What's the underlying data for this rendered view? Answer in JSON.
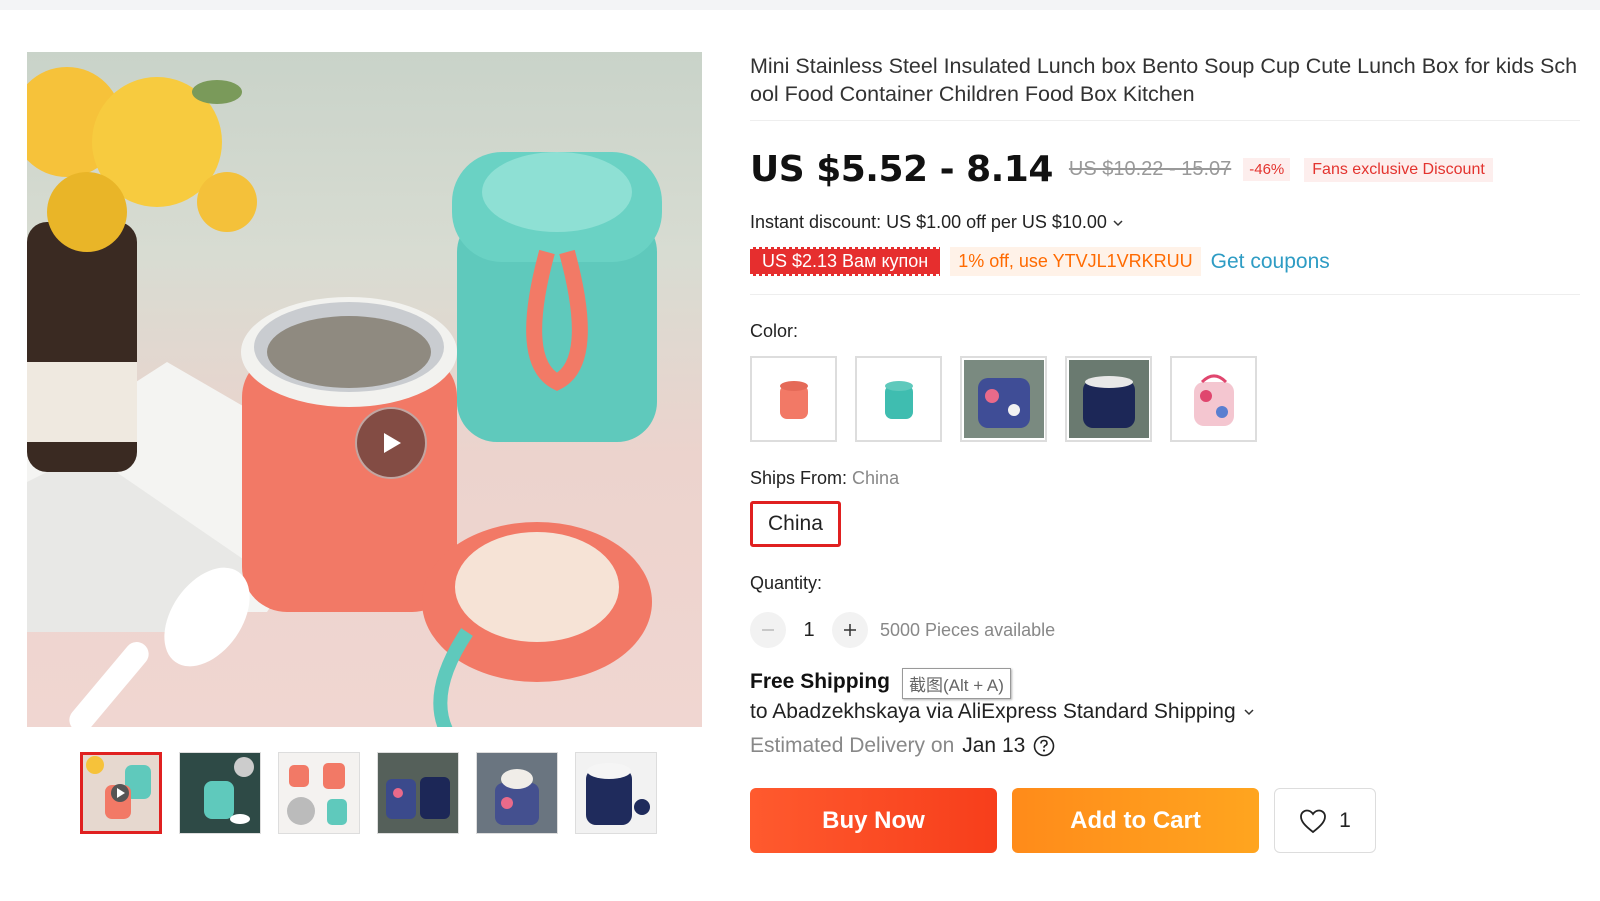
{
  "product": {
    "title": "Mini Stainless Steel Insulated Lunch box Bento Soup Cup Cute Lunch Box for kids School Food Container Children Food Box Kitchen"
  },
  "price": {
    "current": "US $5.52 - 8.14",
    "original": "US $10.22 - 15.07",
    "discount_pct": "-46%",
    "fans_tag": "Fans exclusive Discount"
  },
  "promo": {
    "instant_discount": "Instant discount: US $1.00 off per US $10.00",
    "coupon": "US $2.13 Вам купон",
    "code": "1% off, use YTVJL1VRKRUU",
    "get_coupons": "Get coupons"
  },
  "color": {
    "label": "Color:",
    "options": [
      "coral-jar",
      "teal-jar",
      "floral-bag",
      "navy-bag",
      "pink-bag"
    ]
  },
  "ships": {
    "label": "Ships From:",
    "value": "China",
    "selected": "China"
  },
  "quantity": {
    "label": "Quantity:",
    "value": "1",
    "available": "5000 Pieces available"
  },
  "tooltip": "截图(Alt + A)",
  "shipping": {
    "free": "Free Shipping",
    "to": "to Abadzekhskaya via AliExpress Standard Shipping",
    "estimated_prefix": "Estimated Delivery on",
    "date": "Jan 13"
  },
  "actions": {
    "buy_now": "Buy Now",
    "add_to_cart": "Add to Cart",
    "wishlist_count": "1"
  },
  "colors": {
    "accent_red": "#e02020",
    "buy": "#f73e1b",
    "cart": "#ffa51f",
    "link": "#2e9cc4"
  }
}
